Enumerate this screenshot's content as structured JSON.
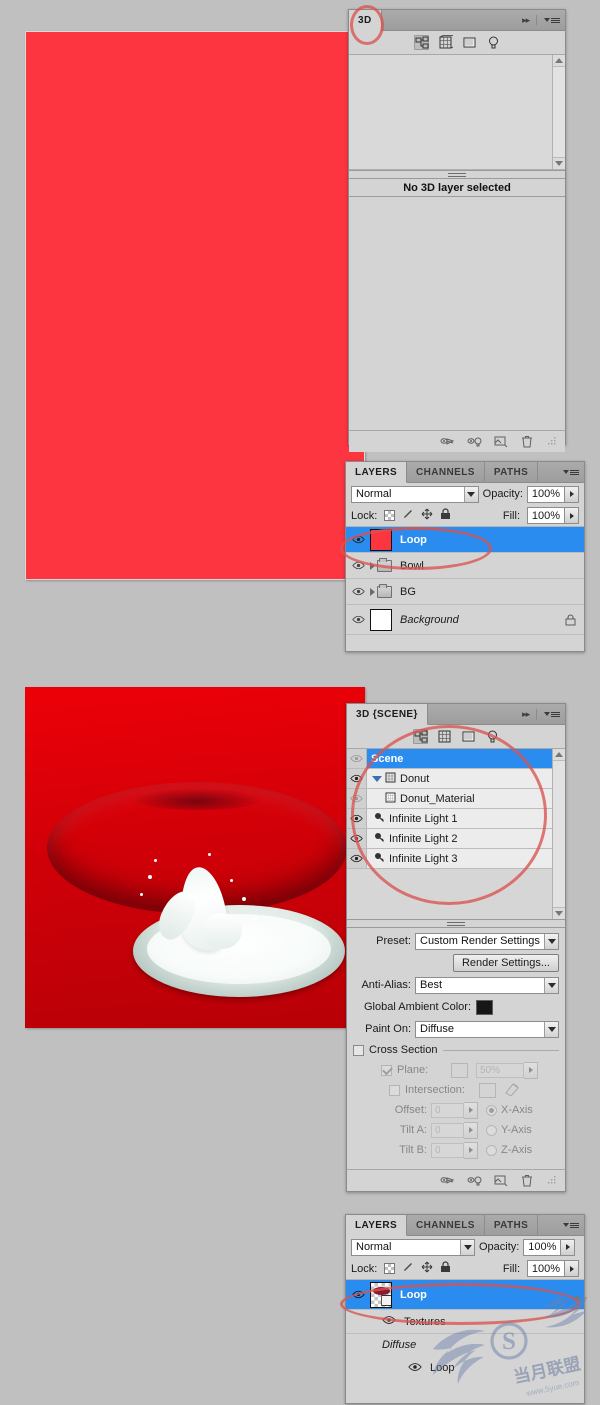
{
  "app": "Adobe Photoshop 3D workflow screenshot",
  "canvas_top": {
    "name": "red-flat-canvas",
    "fill_color": "#fd3540"
  },
  "canvas_bottom": {
    "name": "donut-milk-splash-canvas",
    "background_color": "#d10008",
    "donut_color": "#8a1a2d",
    "milk_color": "#ffffff"
  },
  "panel_3d_top": {
    "tab": "3D",
    "tools": [
      "scene-filter-icon",
      "meshes-filter-icon",
      "materials-filter-icon",
      "lights-filter-icon"
    ],
    "message": "No 3D layer selected",
    "footer_icons": [
      "toggle-ground-plane-icon",
      "toggle-lights-icon",
      "new-layer-icon",
      "delete-icon"
    ],
    "collapse_icon": "▸▸",
    "menu_icon": "panel-menu-icon"
  },
  "layers_panel_top": {
    "tabs": [
      "LAYERS",
      "CHANNELS",
      "PATHS"
    ],
    "active_tab": "LAYERS",
    "blend_mode": "Normal",
    "opacity_label": "Opacity:",
    "opacity_value": "100%",
    "lock_label": "Lock:",
    "lock_icons": [
      "lock-transparent-pixels-icon",
      "lock-image-pixels-icon",
      "lock-position-icon",
      "lock-all-icon"
    ],
    "fill_label": "Fill:",
    "fill_value": "100%",
    "layers": [
      {
        "name": "Loop",
        "thumb": "red",
        "visible": true,
        "selected": true,
        "type": "layer"
      },
      {
        "name": "Bowl",
        "thumb": "folder",
        "visible": true,
        "selected": false,
        "type": "group"
      },
      {
        "name": "BG",
        "thumb": "folder",
        "visible": true,
        "selected": false,
        "type": "group"
      },
      {
        "name": "Background",
        "thumb": "white",
        "visible": true,
        "selected": false,
        "type": "layer",
        "locked": true,
        "italic": true
      }
    ]
  },
  "panel_3d_bottom": {
    "tab": "3D {SCENE}",
    "tools": [
      "scene-filter-icon",
      "meshes-filter-icon",
      "materials-filter-icon",
      "lights-filter-icon"
    ],
    "tree": [
      {
        "label": "Scene",
        "indent": 0,
        "selected": true,
        "visible": false,
        "icon": "none"
      },
      {
        "label": "Donut",
        "indent": 0,
        "selected": false,
        "visible": true,
        "icon": "mesh-icon",
        "expanded": true
      },
      {
        "label": "Donut_Material",
        "indent": 1,
        "selected": false,
        "visible": false,
        "icon": "material-icon"
      },
      {
        "label": "Infinite Light 1",
        "indent": 0,
        "selected": false,
        "visible": true,
        "icon": "light-icon"
      },
      {
        "label": "Infinite Light 2",
        "indent": 0,
        "selected": false,
        "visible": true,
        "icon": "light-icon"
      },
      {
        "label": "Infinite Light 3",
        "indent": 0,
        "selected": false,
        "visible": true,
        "icon": "light-icon"
      }
    ],
    "settings": {
      "preset_label": "Preset:",
      "preset_value": "Custom Render Settings",
      "render_settings_button": "Render Settings...",
      "antialias_label": "Anti-Alias:",
      "antialias_value": "Best",
      "global_ambient_label": "Global Ambient Color:",
      "global_ambient_color": "#161616",
      "paint_on_label": "Paint On:",
      "paint_on_value": "Diffuse",
      "cross_section_label": "Cross Section",
      "cross_section_checked": false,
      "plane_label": "Plane:",
      "plane_checked": true,
      "plane_opacity": "50%",
      "intersection_label": "Intersection:",
      "intersection_checked": false,
      "offset_label": "Offset:",
      "offset_value": "0",
      "tilt_a_label": "Tilt A:",
      "tilt_a_value": "0",
      "tilt_b_label": "Tilt B:",
      "tilt_b_value": "0",
      "axis_options": [
        "X-Axis",
        "Y-Axis",
        "Z-Axis"
      ],
      "axis_selected": "X-Axis"
    },
    "footer_icons": [
      "toggle-ground-plane-icon",
      "toggle-lights-icon",
      "new-layer-icon",
      "delete-icon"
    ]
  },
  "layers_panel_bottom": {
    "tabs": [
      "LAYERS",
      "CHANNELS",
      "PATHS"
    ],
    "active_tab": "LAYERS",
    "blend_mode": "Normal",
    "opacity_label": "Opacity:",
    "opacity_value": "100%",
    "lock_label": "Lock:",
    "fill_label": "Fill:",
    "fill_value": "100%",
    "rows": [
      {
        "name": "Loop",
        "selected": true,
        "visible": true,
        "kind": "3d-layer"
      },
      {
        "name": "Textures",
        "selected": false,
        "visible": true,
        "kind": "sub",
        "indent": 1
      },
      {
        "name": "Diffuse",
        "selected": false,
        "visible": false,
        "kind": "label",
        "indent": 1,
        "italic": true
      },
      {
        "name": "Loop",
        "selected": false,
        "visible": true,
        "kind": "sub",
        "indent": 2
      }
    ]
  },
  "watermark": {
    "text_cn": "当月联盟",
    "url": "www.5yue.com",
    "mark": "S"
  },
  "annotations": [
    {
      "name": "annot-3d-tab"
    },
    {
      "name": "annot-loop-layer"
    },
    {
      "name": "annot-scene-tree"
    },
    {
      "name": "annot-loop-3d-layer"
    }
  ]
}
